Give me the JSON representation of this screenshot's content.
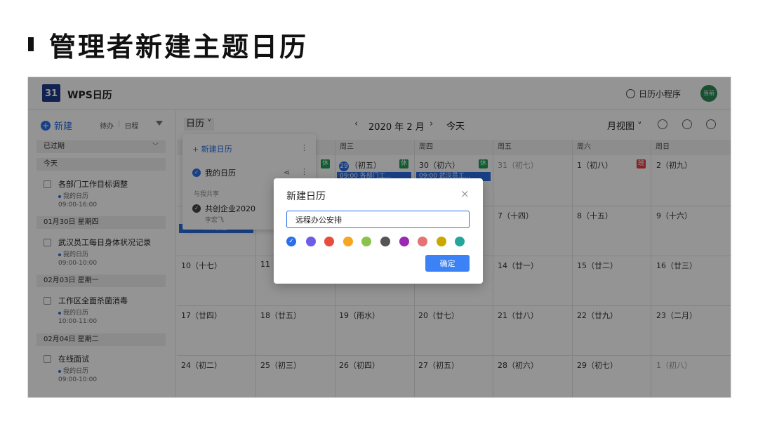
{
  "slide": {
    "title": "管理者新建主题日历"
  },
  "app": {
    "logo": "31",
    "name": "WPS日历",
    "mini_program": "日历小程序",
    "avatar": "当前"
  },
  "sidebar": {
    "new_label": "新建",
    "tabs": [
      "待办",
      "日程"
    ],
    "overdue_label": "已过期",
    "groups": [
      {
        "label": "今天",
        "items": [
          {
            "title": "各部门工作目标调整",
            "calendar": "我的日历",
            "time": "09:00-16:00"
          }
        ]
      },
      {
        "label": "01月30日 星期四",
        "items": [
          {
            "title": "武汉员工每日身体状况记录",
            "calendar": "我的日历",
            "time": "09:00-10:00"
          }
        ]
      },
      {
        "label": "02月03日 星期一",
        "items": [
          {
            "title": "工作区全面杀菌消毒",
            "calendar": "我的日历",
            "time": "10:00-11:00"
          }
        ]
      },
      {
        "label": "02月04日 星期二",
        "items": [
          {
            "title": "在线面试",
            "calendar": "我的日历",
            "time": "09:00-10:00"
          }
        ]
      }
    ]
  },
  "toolbar": {
    "calendar_select": "日历",
    "prev": "‹",
    "next": "›",
    "month": "2020 年 2 月",
    "today": "今天",
    "view": "月视图"
  },
  "weekdays": [
    "周一",
    "周二",
    "周三",
    "周四",
    "周五",
    "周六",
    "周日"
  ],
  "weeks": [
    [
      "",
      "",
      "29（初五）",
      "30（初六）",
      "31（初七）",
      "1（初八）",
      "2（初九）"
    ],
    [
      "",
      "",
      "",
      "",
      "7（十四）",
      "8（十五）",
      "9（十六）"
    ],
    [
      "10（十七）",
      "11",
      "",
      "",
      "14（廿一）",
      "15（廿二）",
      "16（廿三）"
    ],
    [
      "17（廿四）",
      "18（廿五）",
      "19（雨水）",
      "20（廿七）",
      "21（廿八）",
      "22（廿九）",
      "23（二月）"
    ],
    [
      "24（初二）",
      "25（初三）",
      "26（初四）",
      "27（初五）",
      "28（初六）",
      "29（初七）",
      "1（初八）"
    ]
  ],
  "tags": {
    "rest": "休",
    "work": "班"
  },
  "events": {
    "thu29": "09:00 各部门工...",
    "fri30": "09:00 武汉员工...",
    "week2": "10:00 工作区全..."
  },
  "dropdown": {
    "new_calendar": "新建日历",
    "more": "⋮",
    "share": "⋖",
    "my_calendar": "我的日历",
    "shared_section": "与我共享",
    "shared_calendar": "共创企业2020",
    "shared_owner": "李宏飞"
  },
  "dialog": {
    "title": "新建日历",
    "close": "×",
    "input_value": "远程办公安排",
    "ok": "确定",
    "check": "✓",
    "colors": [
      "#2c6fe6",
      "#6c5ce7",
      "#e74c3c",
      "#f5a623",
      "#8bc34a",
      "#555555",
      "#9c27b0",
      "#e57373",
      "#c9a800",
      "#26a69a"
    ]
  }
}
